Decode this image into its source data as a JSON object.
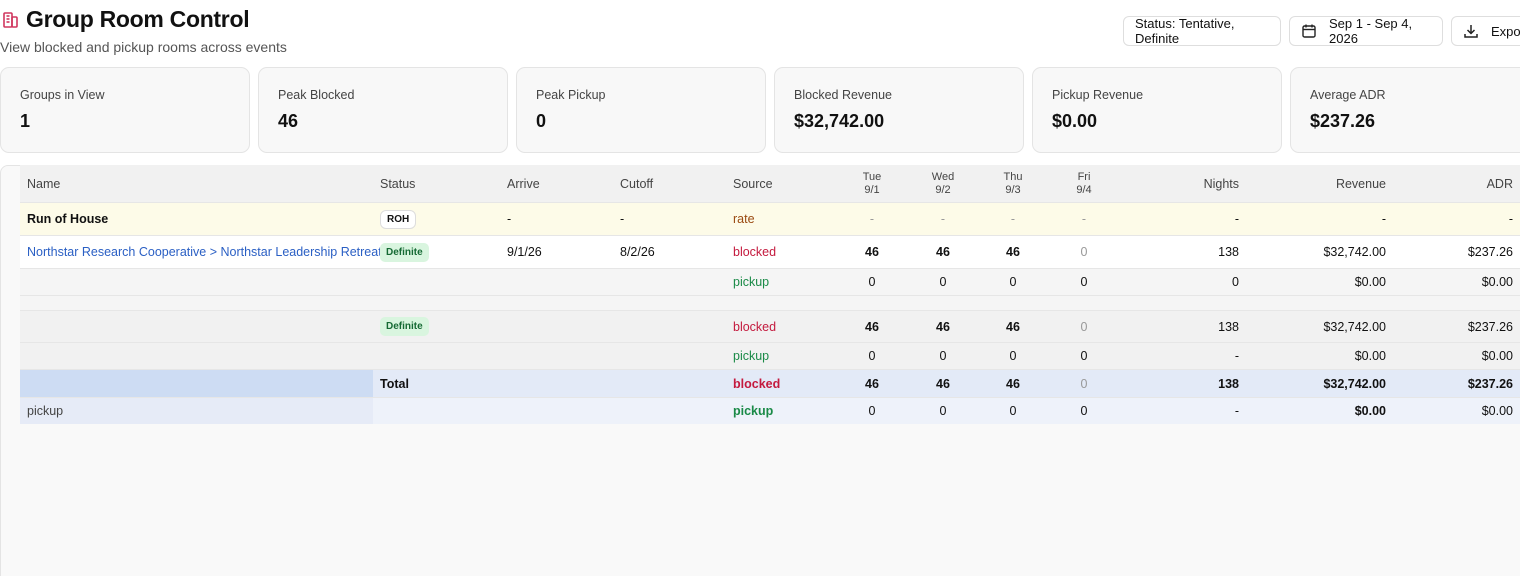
{
  "header": {
    "title": "Group Room Control",
    "subtitle": "View blocked and pickup rooms across events",
    "status_filter": "Status: Tentative, Definite",
    "date_range": "Sep 1 - Sep 4, 2026",
    "export_label": "Expo"
  },
  "cards": [
    {
      "label": "Groups in View",
      "value": "1"
    },
    {
      "label": "Peak Blocked",
      "value": "46"
    },
    {
      "label": "Peak Pickup",
      "value": "0"
    },
    {
      "label": "Blocked Revenue",
      "value": "$32,742.00"
    },
    {
      "label": "Pickup Revenue",
      "value": "$0.00"
    },
    {
      "label": "Average ADR",
      "value": "$237.26"
    }
  ],
  "columns": {
    "name": "Name",
    "status": "Status",
    "arrive": "Arrive",
    "cutoff": "Cutoff",
    "source": "Source",
    "days": [
      {
        "dow": "Tue",
        "date": "9/1"
      },
      {
        "dow": "Wed",
        "date": "9/2"
      },
      {
        "dow": "Thu",
        "date": "9/3"
      },
      {
        "dow": "Fri",
        "date": "9/4"
      }
    ],
    "nights": "Nights",
    "revenue": "Revenue",
    "adr": "ADR"
  },
  "rows": [
    {
      "name": "Run of House",
      "status": "ROH",
      "arrive": "-",
      "cutoff": "-",
      "source": "rate",
      "days": [
        "-",
        "-",
        "-",
        "-"
      ],
      "nights": "-",
      "revenue": "-",
      "adr": "-"
    },
    {
      "name": "Northstar Research Cooperative > Northstar Leadership Retreat",
      "status": "Definite",
      "arrive": "9/1/26",
      "cutoff": "8/2/26",
      "source": "blocked",
      "days": [
        "46",
        "46",
        "46",
        "0"
      ],
      "nights": "138",
      "revenue": "$32,742.00",
      "adr": "$237.26"
    },
    {
      "name": "",
      "status": "",
      "arrive": "",
      "cutoff": "",
      "source": "pickup",
      "days": [
        "0",
        "0",
        "0",
        "0"
      ],
      "nights": "0",
      "revenue": "$0.00",
      "adr": "$0.00"
    },
    {
      "name": "",
      "status": "Definite",
      "arrive": "",
      "cutoff": "",
      "source": "blocked",
      "days": [
        "46",
        "46",
        "46",
        "0"
      ],
      "nights": "138",
      "revenue": "$32,742.00",
      "adr": "$237.26"
    },
    {
      "name": "",
      "status": "",
      "arrive": "",
      "cutoff": "",
      "source": "pickup",
      "days": [
        "0",
        "0",
        "0",
        "0"
      ],
      "nights": "-",
      "revenue": "$0.00",
      "adr": "$0.00"
    },
    {
      "name": "",
      "status": "Total",
      "arrive": "",
      "cutoff": "",
      "source": "blocked",
      "days": [
        "46",
        "46",
        "46",
        "0"
      ],
      "nights": "138",
      "revenue": "$32,742.00",
      "adr": "$237.26"
    },
    {
      "name": "pickup",
      "status": "",
      "arrive": "",
      "cutoff": "",
      "source": "pickup",
      "days": [
        "0",
        "0",
        "0",
        "0"
      ],
      "nights": "-",
      "revenue": "$0.00",
      "adr": "$0.00"
    }
  ]
}
